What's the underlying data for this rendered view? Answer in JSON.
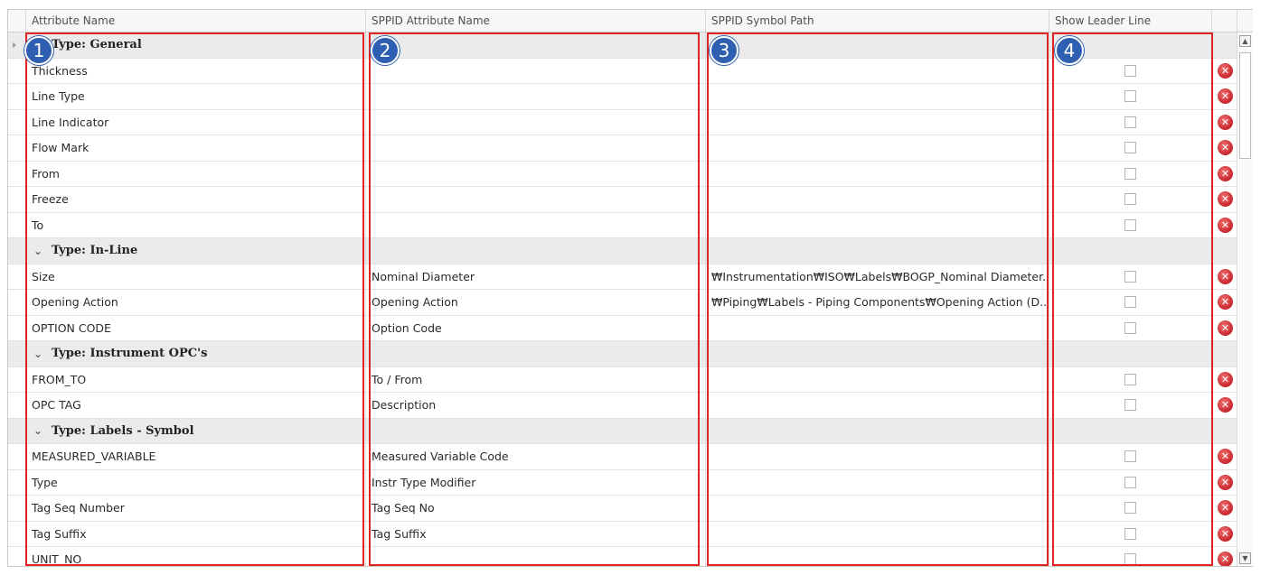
{
  "columns": {
    "attribute_name": "Attribute Name",
    "sppid_attribute_name": "SPPID Attribute Name",
    "sppid_symbol_path": "SPPID Symbol Path",
    "show_leader_line": "Show Leader Line"
  },
  "rows": [
    {
      "kind": "group",
      "label": "Type: General"
    },
    {
      "kind": "item",
      "attr": "Thickness",
      "sppid": "",
      "path": ""
    },
    {
      "kind": "item",
      "attr": "Line Type",
      "sppid": "",
      "path": ""
    },
    {
      "kind": "item",
      "attr": "Line Indicator",
      "sppid": "",
      "path": ""
    },
    {
      "kind": "item",
      "attr": "Flow Mark",
      "sppid": "",
      "path": ""
    },
    {
      "kind": "item",
      "attr": "From",
      "sppid": "",
      "path": ""
    },
    {
      "kind": "item",
      "attr": "Freeze",
      "sppid": "",
      "path": ""
    },
    {
      "kind": "item",
      "attr": "To",
      "sppid": "",
      "path": ""
    },
    {
      "kind": "group",
      "label": "Type: In-Line"
    },
    {
      "kind": "item",
      "attr": "Size",
      "sppid": "Nominal Diameter",
      "path": "₩Instrumentation₩ISO₩Labels₩BOGP_Nominal Diameter...."
    },
    {
      "kind": "item",
      "attr": "Opening Action",
      "sppid": "Opening Action",
      "path": "₩Piping₩Labels - Piping Components₩Opening Action (D..."
    },
    {
      "kind": "item",
      "attr": "OPTION CODE",
      "sppid": "Option Code",
      "path": ""
    },
    {
      "kind": "group",
      "label": "Type: Instrument OPC's"
    },
    {
      "kind": "item",
      "attr": "FROM_TO",
      "sppid": "To / From",
      "path": ""
    },
    {
      "kind": "item",
      "attr": "OPC TAG",
      "sppid": "Description",
      "path": ""
    },
    {
      "kind": "group",
      "label": "Type: Labels - Symbol"
    },
    {
      "kind": "item",
      "attr": "MEASURED_VARIABLE",
      "sppid": "Measured Variable Code",
      "path": ""
    },
    {
      "kind": "item",
      "attr": "Type",
      "sppid": "Instr Type Modifier",
      "path": ""
    },
    {
      "kind": "item",
      "attr": "Tag Seq Number",
      "sppid": "Tag Seq No",
      "path": ""
    },
    {
      "kind": "item",
      "attr": "Tag Suffix",
      "sppid": "Tag Suffix",
      "path": ""
    },
    {
      "kind": "item",
      "attr": "UNIT_NO",
      "sppid": "",
      "path": ""
    }
  ],
  "icons": {
    "chevron": "⌄",
    "delete": "✕",
    "scroll_up": "▲",
    "scroll_down": "▼"
  },
  "annotations": {
    "badges": [
      "1",
      "2",
      "3",
      "4"
    ],
    "colors": {
      "box": "#e02424",
      "badge": "#2f5fb0"
    }
  }
}
